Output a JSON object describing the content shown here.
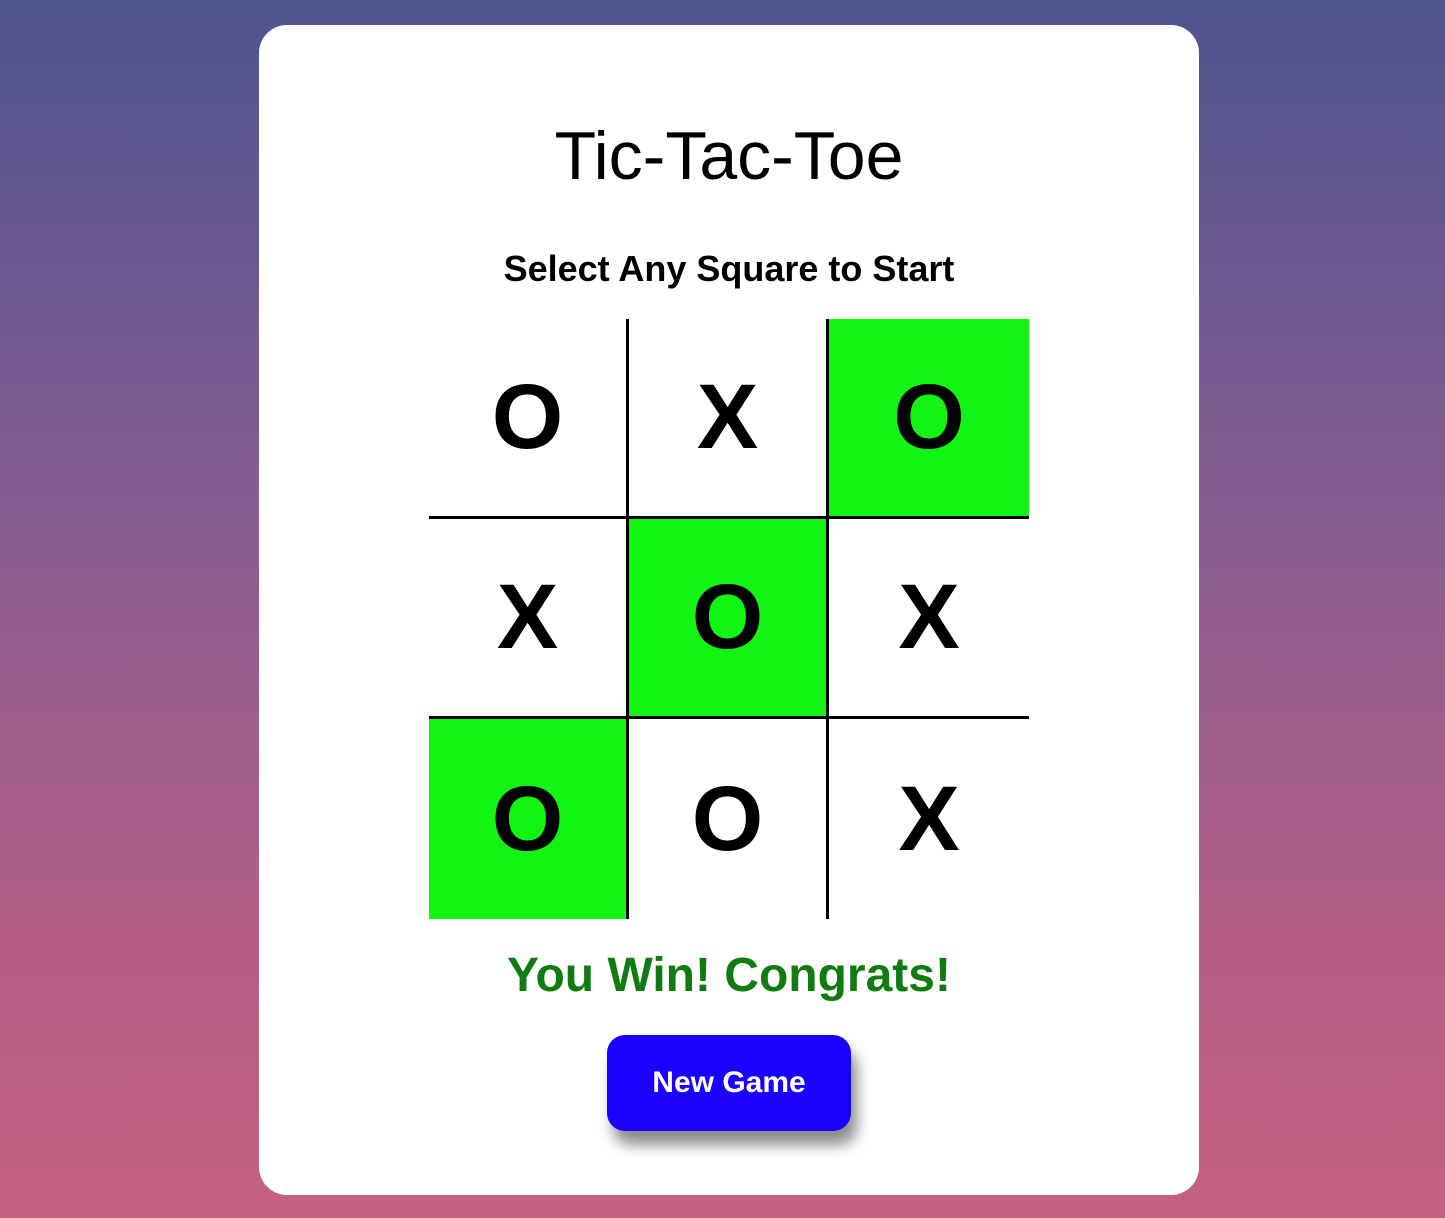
{
  "title": "Tic-Tac-Toe",
  "subtitle": "Select Any Square to Start",
  "board": {
    "cells": [
      {
        "mark": "O",
        "winning": false
      },
      {
        "mark": "X",
        "winning": false
      },
      {
        "mark": "O",
        "winning": true
      },
      {
        "mark": "X",
        "winning": false
      },
      {
        "mark": "O",
        "winning": true
      },
      {
        "mark": "X",
        "winning": false
      },
      {
        "mark": "O",
        "winning": true
      },
      {
        "mark": "O",
        "winning": false
      },
      {
        "mark": "X",
        "winning": false
      }
    ],
    "win_color": "#14f414"
  },
  "message": "You Win! Congrats!",
  "message_color": "#107c10",
  "new_game_label": "New Game",
  "button_color": "#1a00ff"
}
